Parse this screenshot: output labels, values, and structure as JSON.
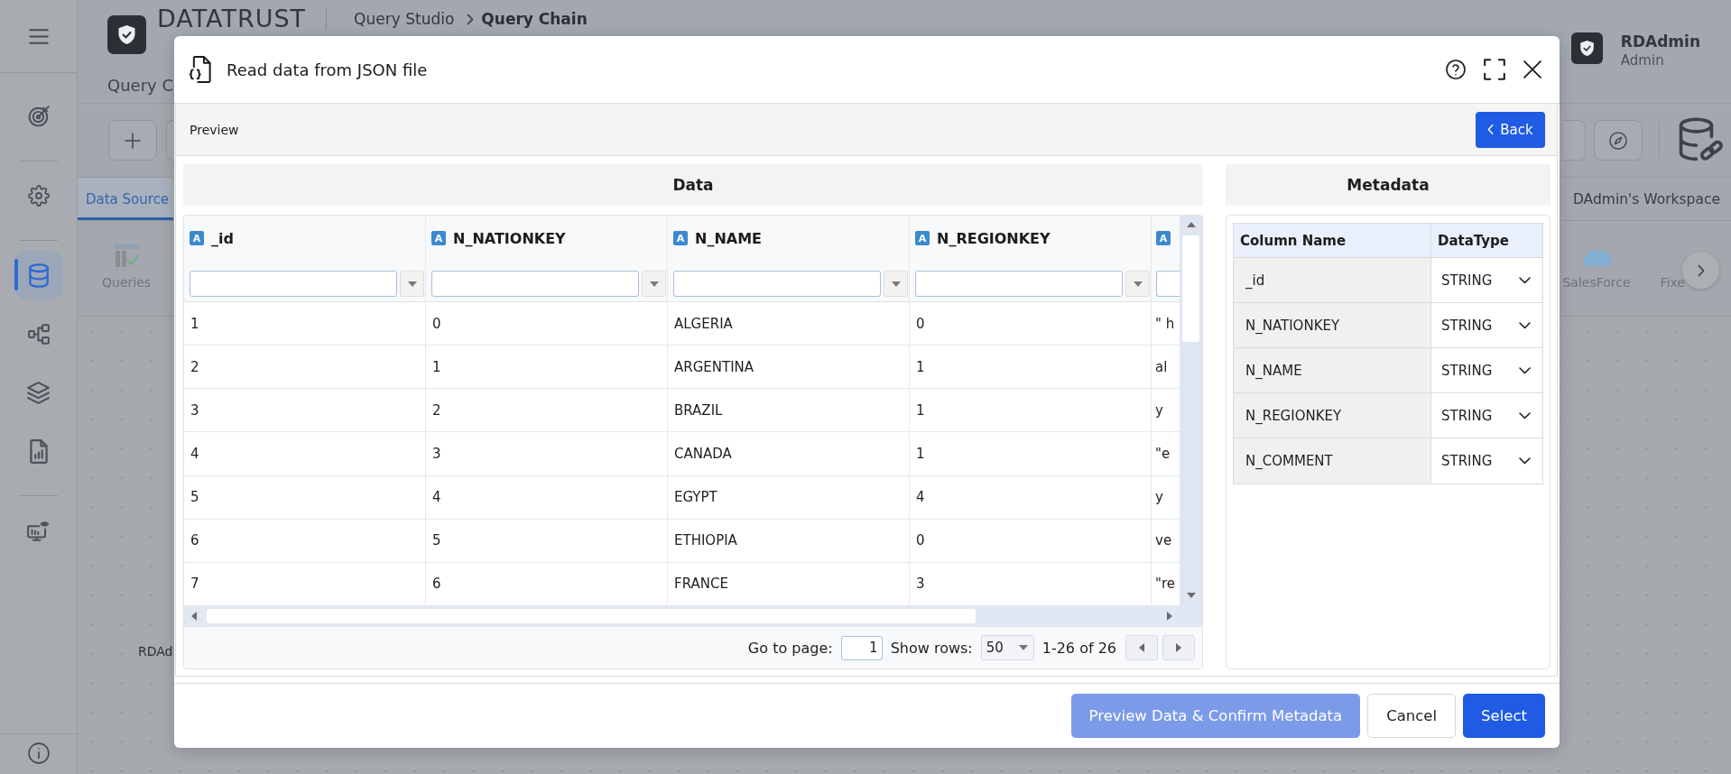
{
  "sidebar": {
    "groups": [
      {
        "items": [
          {
            "selected": false
          }
        ]
      },
      {
        "items": [
          {
            "selected": false
          }
        ]
      },
      {
        "items": [
          {
            "selected": true
          },
          {
            "selected": false
          },
          {
            "selected": false
          },
          {
            "selected": false
          }
        ]
      },
      {
        "items": [
          {
            "selected": false
          }
        ]
      }
    ]
  },
  "app_header": {
    "brand": "DATATRUST",
    "breadcrumb": [
      {
        "label": "Query Studio",
        "current": false
      },
      {
        "label": "Query Chain",
        "current": true
      }
    ],
    "page_title": "Query C",
    "user": {
      "name": "RDAdmin",
      "role": "Admin"
    }
  },
  "tabs": [
    {
      "label": "Data Source",
      "selected": true
    },
    {
      "label": "DAdmin's Workspace",
      "selected": false
    }
  ],
  "connectors": {
    "left": [
      {
        "label": "Queries"
      }
    ],
    "right": [
      {
        "label": "SalesForce"
      },
      {
        "label": "Fixe"
      }
    ]
  },
  "canvas": {
    "node_label": "RDAd"
  },
  "dialog": {
    "title": "Read data from JSON file",
    "section": "Preview",
    "back_button": "Back",
    "data_panel": {
      "title": "Data",
      "columns": [
        {
          "badge": "A",
          "label": "_id"
        },
        {
          "badge": "A",
          "label": "N_NATIONKEY"
        },
        {
          "badge": "A",
          "label": "N_NAME"
        },
        {
          "badge": "A",
          "label": "N_REGIONKEY"
        },
        {
          "badge": "A"
        }
      ],
      "rows": [
        [
          "1",
          "0",
          "ALGERIA",
          "0",
          "\" h"
        ],
        [
          "2",
          "1",
          "ARGENTINA",
          "1",
          "al"
        ],
        [
          "3",
          "2",
          "BRAZIL",
          "1",
          "y"
        ],
        [
          "4",
          "3",
          "CANADA",
          "1",
          "\"e"
        ],
        [
          "5",
          "4",
          "EGYPT",
          "4",
          "y"
        ],
        [
          "6",
          "5",
          "ETHIOPIA",
          "0",
          "ve"
        ],
        [
          "7",
          "6",
          "FRANCE",
          "3",
          "\"re"
        ]
      ],
      "pager": {
        "go_to_label": "Go to page:",
        "page": "1",
        "rows_label": "Show rows:",
        "rows_per_page": "50",
        "range": "1-26 of 26"
      }
    },
    "metadata_panel": {
      "title": "Metadata",
      "columns": [
        "Column Name",
        "DataType"
      ],
      "rows": [
        {
          "name": "_id",
          "type": "STRING"
        },
        {
          "name": "N_NATIONKEY",
          "type": "STRING"
        },
        {
          "name": "N_NAME",
          "type": "STRING"
        },
        {
          "name": "N_REGIONKEY",
          "type": "STRING"
        },
        {
          "name": "N_COMMENT",
          "type": "STRING"
        }
      ]
    },
    "buttons": [
      {
        "label": "Preview Data & Confirm Metadata",
        "kind": "primary",
        "disabled": true
      },
      {
        "label": "Cancel",
        "kind": "secondary",
        "disabled": false
      },
      {
        "label": "Select",
        "kind": "primary",
        "disabled": false
      }
    ]
  }
}
